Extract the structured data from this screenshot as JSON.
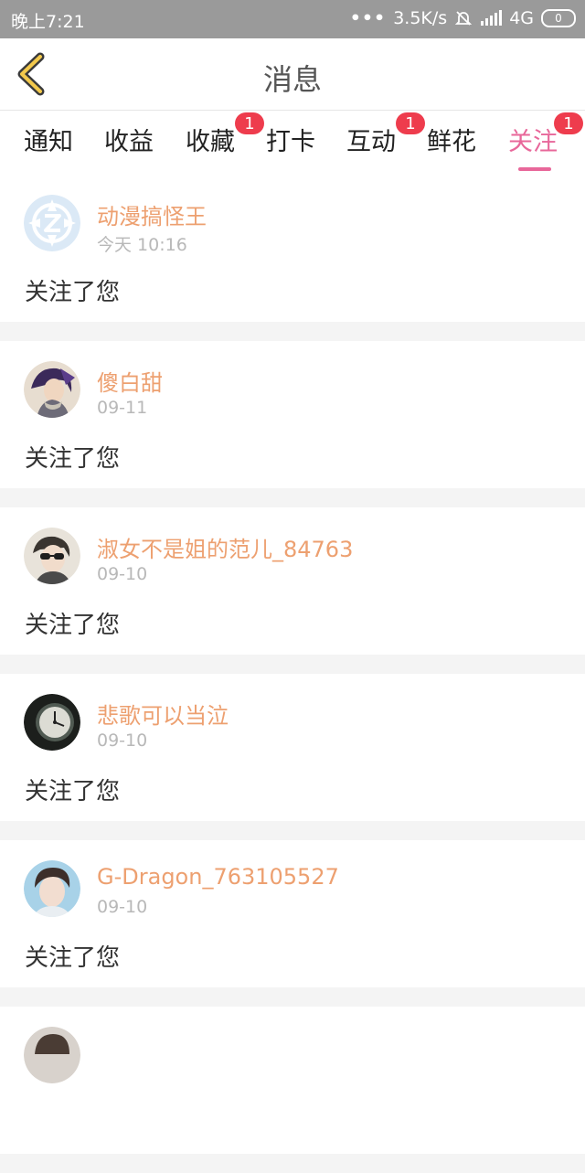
{
  "status_bar": {
    "time": "晚上7:21",
    "dots": "•••",
    "speed": "3.5K/s",
    "network": "4G",
    "battery": "0"
  },
  "header": {
    "title": "消息"
  },
  "tabs": [
    {
      "label": "通知",
      "badge": ""
    },
    {
      "label": "收益",
      "badge": ""
    },
    {
      "label": "收藏",
      "badge": "1"
    },
    {
      "label": "打卡",
      "badge": ""
    },
    {
      "label": "互动",
      "badge": "1"
    },
    {
      "label": "鲜花",
      "badge": ""
    },
    {
      "label": "关注",
      "badge": "1",
      "active": true
    }
  ],
  "messages": [
    {
      "name": "动漫搞怪王",
      "date": "今天 10:16",
      "action": "关注了您",
      "avatar": "default-avatar"
    },
    {
      "name": "傻白甜",
      "date": "09-11",
      "action": "关注了您",
      "avatar": "anime-character-avatar"
    },
    {
      "name": "淑女不是姐的范儿_84763",
      "date": "09-10",
      "action": "关注了您",
      "avatar": "sunglasses-girl-avatar"
    },
    {
      "name": "悲歌可以当泣",
      "date": "09-10",
      "action": "关注了您",
      "avatar": "pocket-watch-avatar"
    },
    {
      "name": "G-Dragon_763105527",
      "date": "09-10",
      "action": "关注了您",
      "avatar": "young-man-avatar"
    },
    {
      "name": "",
      "date": "",
      "action": "",
      "avatar": "partial-avatar"
    }
  ],
  "colors": {
    "accent": "#e8679a",
    "username": "#eda070",
    "badge": "#ee3c4d"
  }
}
